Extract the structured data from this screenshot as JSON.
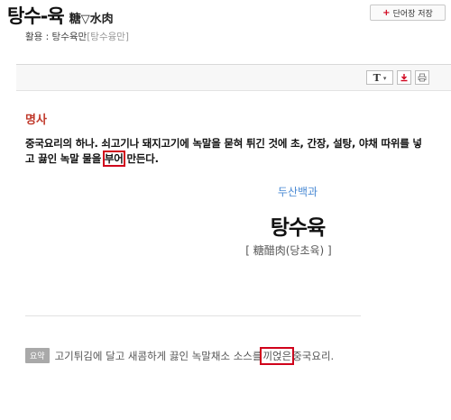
{
  "entry": {
    "title": "탕수-육",
    "hanja": "糖▽水肉",
    "save_button": "단어장 저장",
    "save_plus": "+",
    "usage_label": "활용 : ",
    "usage_word": "탕수육만",
    "usage_pron": "[탕수융만]"
  },
  "toolbar": {
    "font_button": "T",
    "font_caret": "▾",
    "download_icon": "download-icon",
    "print_icon": "print-icon"
  },
  "definition": {
    "pos": "명사",
    "text_before": "중국요리의 하나. 쇠고기나 돼지고기에 녹말을 묻혀 튀긴 것에 초, 간장, 설탕, 야채 따위를 넣고 끓인 녹말 물을 ",
    "highlight": "부어",
    "text_after": " 만든다."
  },
  "encyclopedia": {
    "source": "두산백과",
    "word": "탕수육",
    "hanja_line": "[ 糖醋肉(당초육) ]",
    "summary_badge": "요약",
    "summary_before": "고기튀김에 달고 새콤하게 끓인 녹말채소 소스를 ",
    "summary_highlight": "끼얹은",
    "summary_after": " 중국요리."
  },
  "colors": {
    "pos_red": "#c0392b",
    "highlight_red": "#d0021b",
    "source_blue": "#4a8ad4"
  }
}
